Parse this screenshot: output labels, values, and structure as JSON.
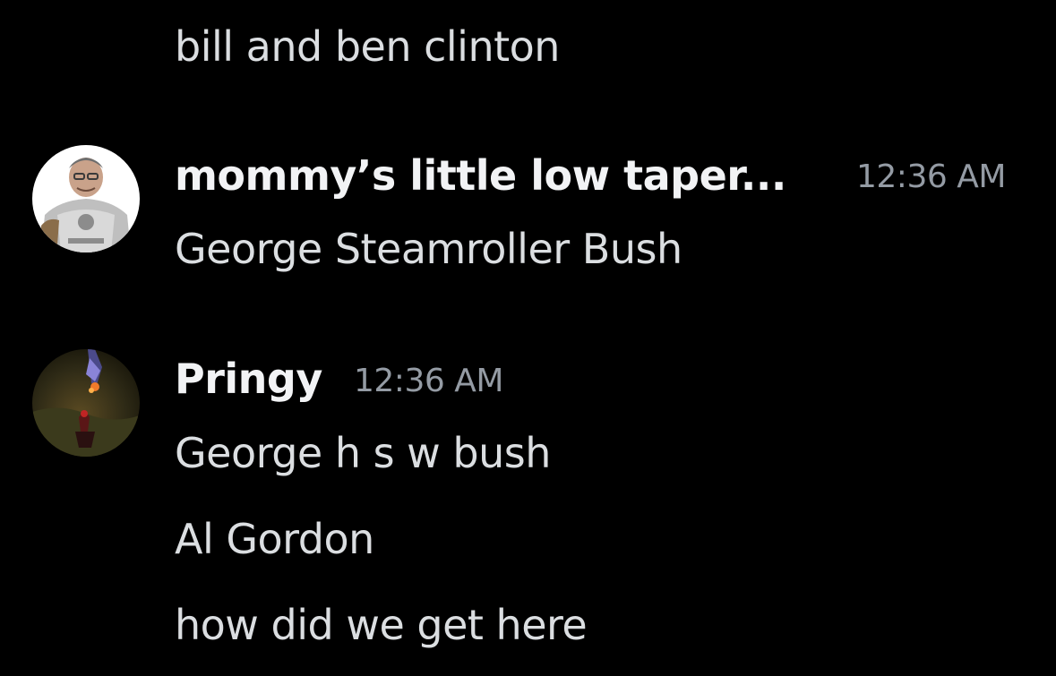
{
  "messages": {
    "continuation": {
      "text": "bill and ben clinton"
    },
    "group1": {
      "author": "mommy’s little low taper...",
      "timestamp": "12:36 AM",
      "lines": [
        "George Steamroller Bush"
      ],
      "avatar_icon": "armored-character-avatar"
    },
    "group2": {
      "author": "Pringy",
      "timestamp": "12:36 AM",
      "lines": [
        "George h s w bush",
        "Al Gordon",
        "how did we get here"
      ],
      "avatar_icon": "game-scene-avatar"
    }
  },
  "colors": {
    "background": "#000000",
    "author": "#f2f3f5",
    "message": "#dbdee1",
    "timestamp": "#949ba4"
  }
}
